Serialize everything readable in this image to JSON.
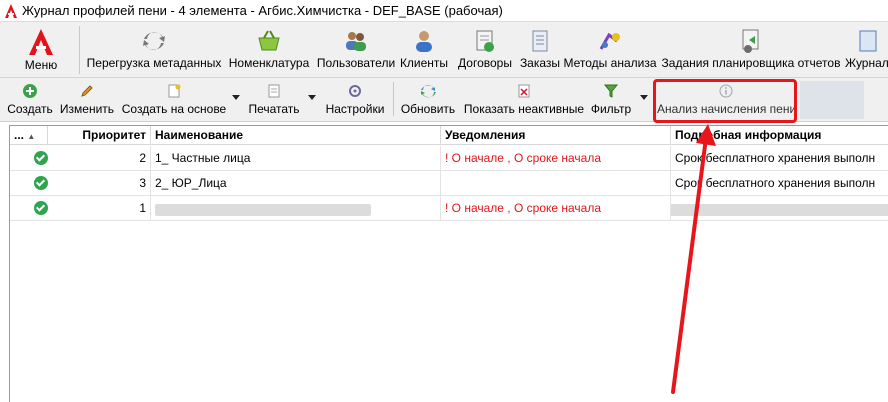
{
  "window": {
    "title": "Журнал профилей пени - 4 элемента - Агбис.Химчистка - DEF_BASE (рабочая)"
  },
  "ribbon": {
    "menu_label": "Меню",
    "items": [
      {
        "label": "Перегрузка метаданных",
        "icon": "refresh-metadata-icon"
      },
      {
        "label": "Номенклатура",
        "icon": "basket-icon"
      },
      {
        "label": "Пользователи",
        "icon": "users-icon"
      },
      {
        "label": "Клиенты",
        "icon": "client-icon"
      },
      {
        "label": "Договоры",
        "icon": "contract-icon"
      },
      {
        "label": "Заказы",
        "icon": "orders-icon"
      },
      {
        "label": "Методы анализа",
        "icon": "analysis-methods-icon"
      },
      {
        "label": "Задания планировщика отчетов",
        "icon": "scheduler-icon"
      },
      {
        "label": "Журнал",
        "icon": "journal-icon"
      }
    ]
  },
  "toolbar": {
    "create": "Создать",
    "edit": "Изменить",
    "create_based": "Создать на основе",
    "print": "Печатать",
    "settings": "Настройки",
    "refresh": "Обновить",
    "show_inactive": "Показать неактивные",
    "filter": "Фильтр",
    "analysis": "Анализ начисления пени"
  },
  "grid": {
    "columns": [
      "...",
      "Приоритет",
      "Наименование",
      "Уведомления",
      "Подробная информация"
    ],
    "rows": [
      {
        "priority": "2",
        "name": "1_ Частные лица",
        "notifications": "! О начале , О сроке начала",
        "details": "Срок бесплатного хранения выполн"
      },
      {
        "priority": "3",
        "name": "2_ ЮР_Лица",
        "notifications": "",
        "details": "Срок бесплатного хранения выполн"
      },
      {
        "priority": "1",
        "name": "",
        "notifications": "! О начале , О сроке начала",
        "details": ""
      }
    ]
  },
  "colors": {
    "accent_red": "#e8151b",
    "notification_red": "#e0161b",
    "active_green": "#2ea44f"
  }
}
